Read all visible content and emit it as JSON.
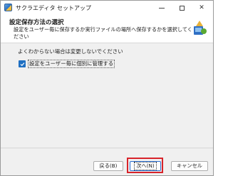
{
  "window": {
    "title": "サクラエディタ セットアップ",
    "minimize_symbol": "",
    "restore_symbol": "",
    "close_symbol": "✕"
  },
  "header": {
    "title": "設定保存方法の選択",
    "description": "設定をユーザー毎に保存するか実行ファイルの場所へ保存するかを選択してください"
  },
  "content": {
    "hint": "よくわからない場合は変更しないでください",
    "checkbox": {
      "label": "設定をユーザー毎に個別に管理する",
      "checked": true
    }
  },
  "buttons": {
    "back_label": "戻る(B)",
    "next_label": "次へ(N)",
    "cancel_label": "キャンセル"
  },
  "colors": {
    "highlight": "#d8232a",
    "checkbox_accent": "#1f6fc2",
    "default_button_border": "#2a6ed0"
  }
}
